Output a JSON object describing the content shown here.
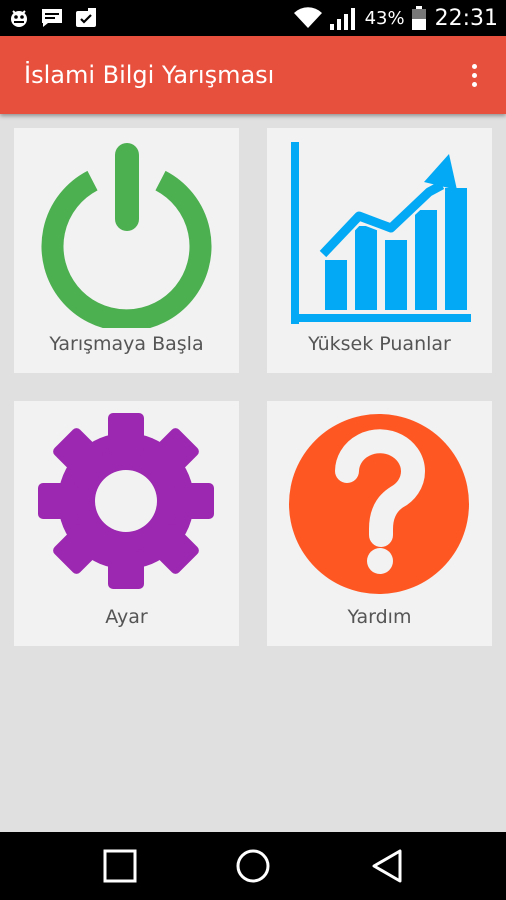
{
  "status_bar": {
    "notification_icons": [
      "android-debug-icon",
      "message-icon",
      "checklist-notification-icon"
    ],
    "battery_percent": "43%",
    "time": "22:31"
  },
  "app_bar": {
    "title": "İslami Bilgi Yarışması"
  },
  "tiles": [
    {
      "label": "Yarışmaya Başla",
      "icon": "power-icon",
      "color": "#4caf50"
    },
    {
      "label": "Yüksek Puanlar",
      "icon": "bar-chart-icon",
      "color": "#03a9f4"
    },
    {
      "label": "Ayar",
      "icon": "gear-icon",
      "color": "#9c27b0"
    },
    {
      "label": "Yardım",
      "icon": "question-icon",
      "color": "#ff5722"
    }
  ],
  "colors": {
    "app_bar": "#e8503e",
    "background": "#e0e0e0",
    "tile": "#f2f2f2"
  },
  "nav_bar": {
    "buttons": [
      "recent-apps-icon",
      "home-icon",
      "back-icon"
    ]
  }
}
